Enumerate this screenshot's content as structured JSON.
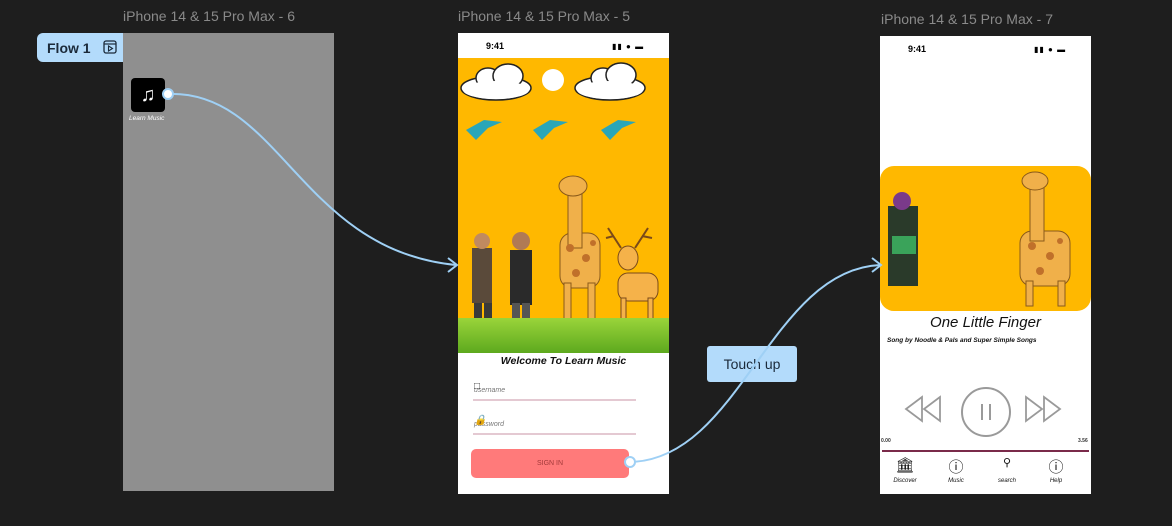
{
  "canvas": {
    "frames": [
      {
        "title": "iPhone 14 & 15 Pro Max - 6"
      },
      {
        "title": "iPhone 14 & 15 Pro Max - 5"
      },
      {
        "title": "iPhone 14 & 15 Pro Max - 7"
      }
    ],
    "flow_label": "Flow 1",
    "interaction_label": "Touch up"
  },
  "frame6": {
    "app_label": "Learn Music",
    "app_icon": "music-notes-icon"
  },
  "frame5": {
    "time": "9:41",
    "welcome": "Welcome To Learn Music",
    "username_placeholder": "username",
    "password_placeholder": "password",
    "signin_label": "SIGN IN"
  },
  "frame7": {
    "time": "9:41",
    "song_title": "One Little Finger",
    "song_subtitle": "Song by Noodle & Pals and Super Simple Songs",
    "time_start": "0.00",
    "time_end": "3.56",
    "nav": [
      {
        "label": "Discover",
        "icon": "bank-icon"
      },
      {
        "label": "Music",
        "icon": "question-music-icon"
      },
      {
        "label": "search",
        "icon": "search-icon"
      },
      {
        "label": "Help",
        "icon": "help-icon"
      }
    ]
  },
  "colors": {
    "canvas_bg": "#1e1e1e",
    "accent_chip": "#b3dbfb",
    "scene_orange": "#ffb800",
    "signin": "#ff7a7a",
    "connector": "#9fd0f5"
  }
}
